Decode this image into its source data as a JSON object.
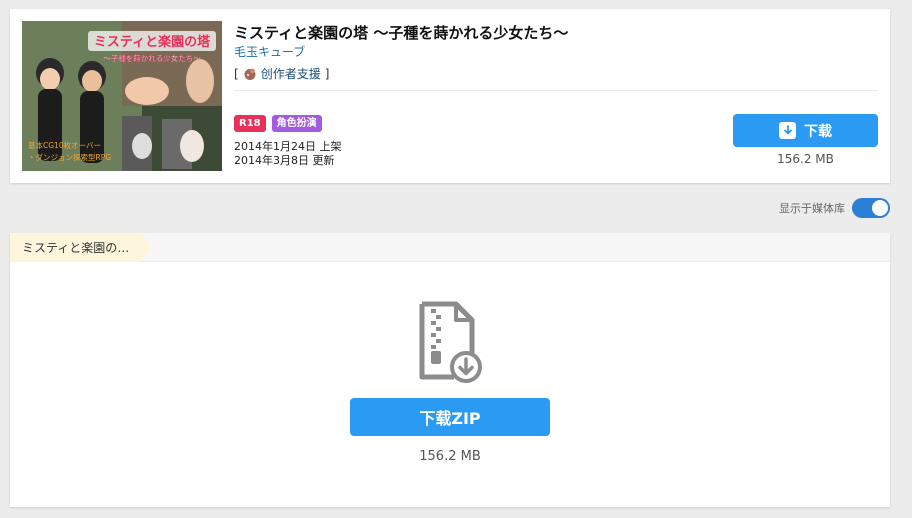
{
  "work": {
    "title": "ミスティと楽園の塔 ～子種を蒔かれる少女たち～",
    "circle": "毛玉キューブ",
    "support_open": "[",
    "support_label": "创作者支援",
    "support_close": "]",
    "thumbnail_title": "ミスティと楽園の塔",
    "thumbnail_subtitle": "～子種を蒔かれる少女たち～",
    "thumbnail_caption1": "基本CG10枚オーバー",
    "thumbnail_caption2": "・ダンジョン探索型RPG",
    "tags": [
      {
        "label": "R18",
        "color": "#e8305b"
      },
      {
        "label": "角色扮演",
        "color": "#a35be0"
      }
    ],
    "release_date": "2014年1月24日 上架",
    "update_date": "2014年3月8日 更新",
    "download_label": "下载",
    "file_size": "156.2 MB"
  },
  "library": {
    "label": "显示于媒体库",
    "enabled": true
  },
  "panel": {
    "breadcrumb": "ミスティと楽園の…",
    "zip_button_label": "下载ZIP",
    "zip_size": "156.2 MB"
  },
  "colors": {
    "accent": "#2b9af3",
    "toggle": "#2b7fd6",
    "link": "#1a6fa8"
  },
  "icons": [
    "download-icon",
    "zip-file-icon",
    "support-icon"
  ]
}
